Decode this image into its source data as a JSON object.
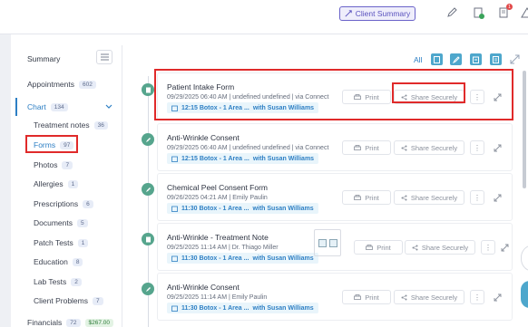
{
  "header": {
    "client_summary_label": "Client Summary",
    "icons": [
      "edit-icon",
      "clipboard-check-icon",
      "notes-icon",
      "alert-icon"
    ],
    "notification_count": "1"
  },
  "sidebar": {
    "summary_label": "Summary",
    "appointments": {
      "label": "Appointments",
      "count": "602"
    },
    "chart": {
      "label": "Chart",
      "count": "134"
    },
    "sub_items": [
      {
        "label": "Treatment notes",
        "count": "36"
      },
      {
        "label": "Forms",
        "count": "97"
      },
      {
        "label": "Photos",
        "count": "7"
      },
      {
        "label": "Allergies",
        "count": "1"
      },
      {
        "label": "Prescriptions",
        "count": "6"
      },
      {
        "label": "Documents",
        "count": "5"
      },
      {
        "label": "Patch Tests",
        "count": "1"
      },
      {
        "label": "Education",
        "count": "8"
      },
      {
        "label": "Lab Tests",
        "count": "2"
      },
      {
        "label": "Client Problems",
        "count": "7"
      }
    ],
    "financials": {
      "label": "Financials",
      "count": "72",
      "amount": "$267.00"
    }
  },
  "filters": {
    "all_label": "All"
  },
  "entries": [
    {
      "title": "Patient Intake Form",
      "meta": "09/29/2025 06:40 AM | undefined undefined | via Connect",
      "appt_time": "12:15 Botox - 1 Area ...",
      "appt_with": "with Susan Williams",
      "print": "Print",
      "share": "Share Securely"
    },
    {
      "title": "Anti-Wrinkle Consent",
      "meta": "09/29/2025 06:40 AM | undefined undefined | via Connect",
      "appt_time": "12:15 Botox - 1 Area ...",
      "appt_with": "with Susan Williams",
      "print": "Print",
      "share": "Share Securely"
    },
    {
      "title": "Chemical Peel Consent Form",
      "meta": "09/26/2025 04:21 AM | Emily Paulin",
      "appt_time": "11:30 Botox - 1 Area ...",
      "appt_with": "with Susan Williams",
      "print": "Print",
      "share": "Share Securely"
    },
    {
      "title": "Anti-Wrinkle - Treatment Note",
      "meta": "09/25/2025 11:14 AM | Dr. Thiago Miller",
      "appt_time": "11:30 Botox - 1 Area ...",
      "appt_with": "with Susan Williams",
      "print": "Print",
      "share": "Share Securely"
    },
    {
      "title": "Anti-Wrinkle Consent",
      "meta": "09/25/2025 11:14 AM | Emily Paulin",
      "appt_time": "11:30 Botox - 1 Area ...",
      "appt_with": "with Susan Williams",
      "print": "Print",
      "share": "Share Securely"
    }
  ],
  "colors": {
    "accent": "#2d7fc4",
    "highlight": "#e02a2a",
    "timeline_icon": "#56a58d",
    "client_summary": "#5a52be"
  }
}
